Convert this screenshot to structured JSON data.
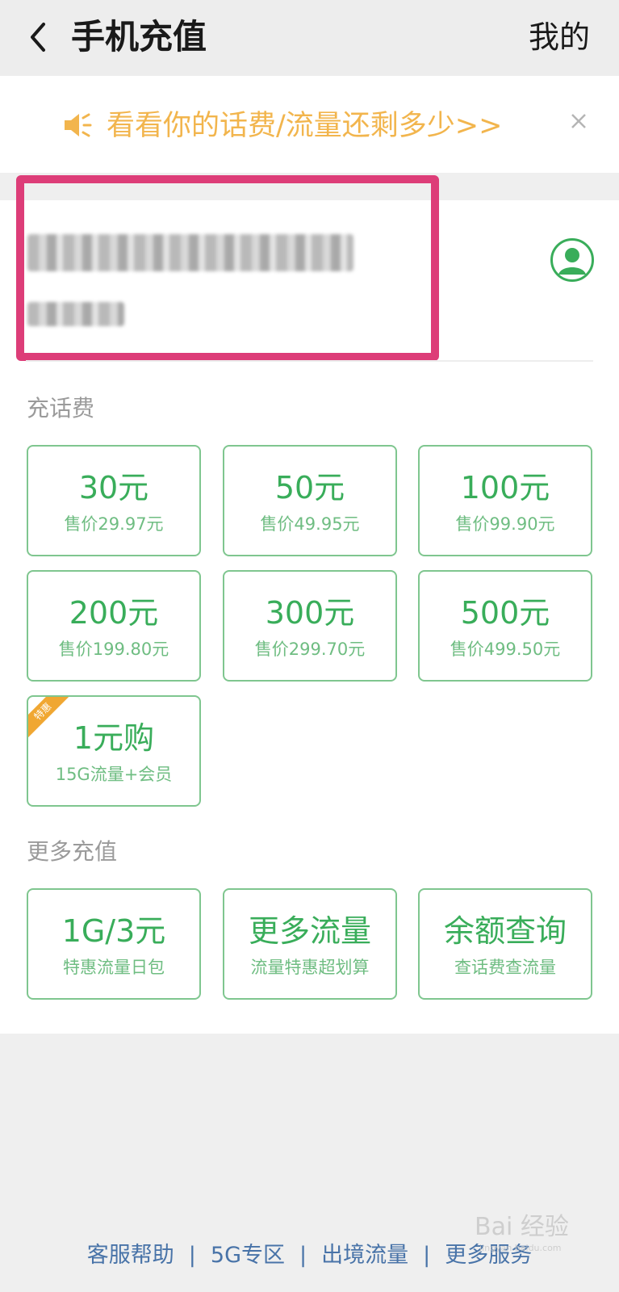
{
  "header": {
    "title": "手机充值",
    "mine_label": "我的"
  },
  "notice": {
    "text": "看看你的话费/流量还剩多少>>",
    "speaker_icon": "speaker-icon",
    "close_icon": "close-icon"
  },
  "account": {
    "phone_number": "",
    "carrier": "",
    "avatar_icon": "user-avatar-icon"
  },
  "recharge": {
    "section_title": "充话费",
    "options": [
      {
        "amount": "30元",
        "price": "售价29.97元"
      },
      {
        "amount": "50元",
        "price": "售价49.95元"
      },
      {
        "amount": "100元",
        "price": "售价99.90元"
      },
      {
        "amount": "200元",
        "price": "售价199.80元"
      },
      {
        "amount": "300元",
        "price": "售价299.70元"
      },
      {
        "amount": "500元",
        "price": "售价499.50元"
      },
      {
        "amount": "1元购",
        "price": "15G流量+会员",
        "badge": "特惠"
      }
    ]
  },
  "more": {
    "section_title": "更多充值",
    "options": [
      {
        "title": "1G/3元",
        "desc": "特惠流量日包"
      },
      {
        "title": "更多流量",
        "desc": "流量特惠超划算"
      },
      {
        "title": "余额查询",
        "desc": "查话费查流量"
      }
    ]
  },
  "footer": {
    "links": [
      "客服帮助",
      "5G专区",
      "出境流量",
      "更多服务"
    ]
  },
  "watermark": {
    "text": "Bai 经验",
    "sub": "jingyan.baidu.com"
  },
  "colors": {
    "accent_green": "#39ad5a",
    "notice_orange": "#f2b54d",
    "highlight_pink": "#dd3d78",
    "link_blue": "#4873a8"
  }
}
